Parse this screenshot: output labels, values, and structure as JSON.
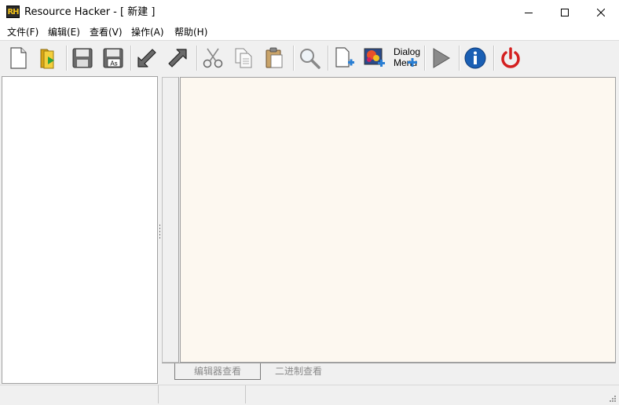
{
  "window": {
    "app_icon_text": "RH",
    "title": "Resource Hacker - [ 新建 ]"
  },
  "menu": {
    "items": [
      {
        "label": "文件(F)"
      },
      {
        "label": "编辑(E)"
      },
      {
        "label": "查看(V)"
      },
      {
        "label": "操作(A)"
      },
      {
        "label": "帮助(H)"
      }
    ]
  },
  "toolbar": {
    "buttons": [
      {
        "icon": "new-file-icon"
      },
      {
        "icon": "open-folder-icon"
      },
      {
        "icon": "save-icon"
      },
      {
        "icon": "save-as-icon",
        "label": "As"
      },
      {
        "icon": "arrow-back-icon"
      },
      {
        "icon": "arrow-forward-icon"
      },
      {
        "icon": "cut-icon"
      },
      {
        "icon": "copy-icon"
      },
      {
        "icon": "paste-icon"
      },
      {
        "icon": "search-icon"
      },
      {
        "icon": "add-resource-icon"
      },
      {
        "icon": "add-image-resource-icon"
      },
      {
        "icon": "add-dialog-menu-icon",
        "label_line1": "Dialog",
        "label_line2": "Menu"
      },
      {
        "icon": "run-icon"
      },
      {
        "icon": "info-icon"
      },
      {
        "icon": "power-icon"
      }
    ]
  },
  "editor": {
    "tabs": [
      {
        "label": "编辑器查看",
        "active": true
      },
      {
        "label": "二进制查看",
        "active": false
      }
    ],
    "background_color": "#fdf8f0"
  },
  "colors": {
    "arrow": "#555555",
    "info_blue": "#1a5fb4",
    "power_red": "#d42020",
    "folder_yellow": "#f0c020",
    "plus_blue": "#2a7fd4"
  }
}
